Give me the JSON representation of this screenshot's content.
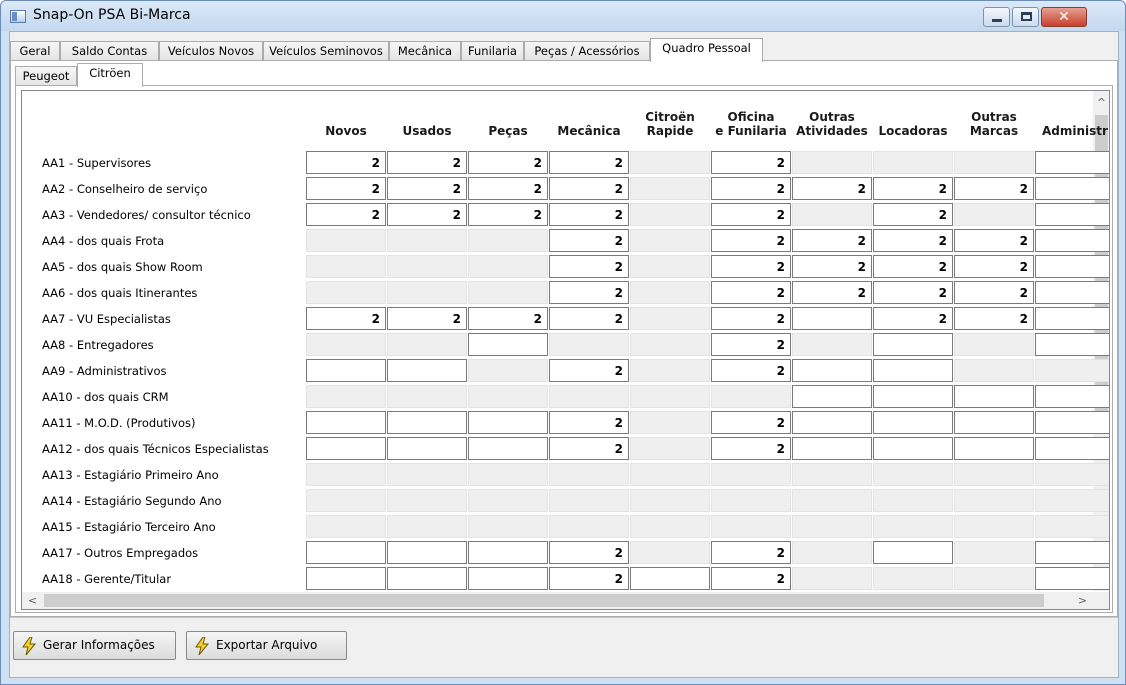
{
  "window": {
    "title": "Snap-On PSA Bi-Marca",
    "close_glyph": "✕"
  },
  "tabs": [
    {
      "label": "Geral"
    },
    {
      "label": "Saldo Contas"
    },
    {
      "label": "Veículos Novos"
    },
    {
      "label": "Veículos Seminovos"
    },
    {
      "label": "Mecânica"
    },
    {
      "label": "Funilaria"
    },
    {
      "label": "Peças / Acessórios"
    },
    {
      "label": "Quadro Pessoal",
      "active": true
    }
  ],
  "subtabs": [
    {
      "label": "Peugeot"
    },
    {
      "label": "Citröen",
      "active": true
    }
  ],
  "grid": {
    "columns": [
      {
        "l1": "",
        "l2": "Novos"
      },
      {
        "l1": "",
        "l2": "Usados"
      },
      {
        "l1": "",
        "l2": "Peças"
      },
      {
        "l1": "",
        "l2": "Mecânica"
      },
      {
        "l1": "Citroën",
        "l2": "Rapide"
      },
      {
        "l1": "Oficina",
        "l2": "e Funilaria"
      },
      {
        "l1": "Outras",
        "l2": "Atividades"
      },
      {
        "l1": "",
        "l2": "Locadoras"
      },
      {
        "l1": "Outras",
        "l2": "Marcas"
      },
      {
        "l1": "",
        "l2": "Administr"
      }
    ],
    "rows": [
      {
        "label": "AA1 - Supervisores",
        "cells": [
          [
            "w",
            "2"
          ],
          [
            "w",
            "2"
          ],
          [
            "w",
            "2"
          ],
          [
            "w",
            "2"
          ],
          [
            "g",
            ""
          ],
          [
            "w",
            "2"
          ],
          [
            "g",
            ""
          ],
          [
            "g",
            ""
          ],
          [
            "g",
            ""
          ],
          [
            "w",
            ""
          ]
        ]
      },
      {
        "label": "AA2 - Conselheiro de serviço",
        "cells": [
          [
            "w",
            "2"
          ],
          [
            "w",
            "2"
          ],
          [
            "w",
            "2"
          ],
          [
            "w",
            "2"
          ],
          [
            "g",
            ""
          ],
          [
            "w",
            "2"
          ],
          [
            "w",
            "2"
          ],
          [
            "w",
            "2"
          ],
          [
            "w",
            "2"
          ],
          [
            "w",
            ""
          ]
        ]
      },
      {
        "label": "AA3 - Vendedores/ consultor técnico",
        "cells": [
          [
            "w",
            "2"
          ],
          [
            "w",
            "2"
          ],
          [
            "w",
            "2"
          ],
          [
            "w",
            "2"
          ],
          [
            "g",
            ""
          ],
          [
            "w",
            "2"
          ],
          [
            "g",
            ""
          ],
          [
            "w",
            "2"
          ],
          [
            "g",
            ""
          ],
          [
            "w",
            ""
          ]
        ]
      },
      {
        "label": "AA4 - dos quais Frota",
        "cells": [
          [
            "g",
            ""
          ],
          [
            "g",
            ""
          ],
          [
            "g",
            ""
          ],
          [
            "w",
            "2"
          ],
          [
            "g",
            ""
          ],
          [
            "w",
            "2"
          ],
          [
            "w",
            "2"
          ],
          [
            "w",
            "2"
          ],
          [
            "w",
            "2"
          ],
          [
            "w",
            ""
          ]
        ]
      },
      {
        "label": "AA5 - dos quais Show Room",
        "cells": [
          [
            "g",
            ""
          ],
          [
            "g",
            ""
          ],
          [
            "g",
            ""
          ],
          [
            "w",
            "2"
          ],
          [
            "g",
            ""
          ],
          [
            "w",
            "2"
          ],
          [
            "w",
            "2"
          ],
          [
            "w",
            "2"
          ],
          [
            "w",
            "2"
          ],
          [
            "w",
            ""
          ]
        ]
      },
      {
        "label": "AA6 - dos quais Itinerantes",
        "cells": [
          [
            "g",
            ""
          ],
          [
            "g",
            ""
          ],
          [
            "g",
            ""
          ],
          [
            "w",
            "2"
          ],
          [
            "g",
            ""
          ],
          [
            "w",
            "2"
          ],
          [
            "w",
            "2"
          ],
          [
            "w",
            "2"
          ],
          [
            "w",
            "2"
          ],
          [
            "w",
            ""
          ]
        ]
      },
      {
        "label": "AA7 - VU Especialistas",
        "cells": [
          [
            "w",
            "2"
          ],
          [
            "w",
            "2"
          ],
          [
            "w",
            "2"
          ],
          [
            "w",
            "2"
          ],
          [
            "g",
            ""
          ],
          [
            "w",
            "2"
          ],
          [
            "w",
            ""
          ],
          [
            "w",
            "2"
          ],
          [
            "w",
            "2"
          ],
          [
            "w",
            ""
          ]
        ]
      },
      {
        "label": "AA8 - Entregadores",
        "cells": [
          [
            "g",
            ""
          ],
          [
            "g",
            ""
          ],
          [
            "w",
            ""
          ],
          [
            "g",
            ""
          ],
          [
            "g",
            ""
          ],
          [
            "w",
            "2"
          ],
          [
            "g",
            ""
          ],
          [
            "w",
            ""
          ],
          [
            "g",
            ""
          ],
          [
            "w",
            ""
          ]
        ]
      },
      {
        "label": "AA9 - Administrativos",
        "cells": [
          [
            "w",
            ""
          ],
          [
            "w",
            ""
          ],
          [
            "g",
            ""
          ],
          [
            "w",
            "2"
          ],
          [
            "g",
            ""
          ],
          [
            "w",
            "2"
          ],
          [
            "w",
            ""
          ],
          [
            "w",
            ""
          ],
          [
            "g",
            ""
          ],
          [
            "g",
            ""
          ]
        ]
      },
      {
        "label": "AA10 - dos quais CRM",
        "cells": [
          [
            "g",
            ""
          ],
          [
            "g",
            ""
          ],
          [
            "g",
            ""
          ],
          [
            "g",
            ""
          ],
          [
            "g",
            ""
          ],
          [
            "g",
            ""
          ],
          [
            "w",
            ""
          ],
          [
            "w",
            ""
          ],
          [
            "w",
            ""
          ],
          [
            "w",
            ""
          ]
        ]
      },
      {
        "label": "AA11 - M.O.D. (Produtivos)",
        "cells": [
          [
            "w",
            ""
          ],
          [
            "w",
            ""
          ],
          [
            "w",
            ""
          ],
          [
            "w",
            "2"
          ],
          [
            "g",
            ""
          ],
          [
            "w",
            "2"
          ],
          [
            "w",
            ""
          ],
          [
            "w",
            ""
          ],
          [
            "w",
            ""
          ],
          [
            "w",
            ""
          ]
        ]
      },
      {
        "label": "AA12 - dos quais Técnicos Especialistas",
        "cells": [
          [
            "w",
            ""
          ],
          [
            "w",
            ""
          ],
          [
            "w",
            ""
          ],
          [
            "w",
            "2"
          ],
          [
            "g",
            ""
          ],
          [
            "w",
            "2"
          ],
          [
            "w",
            ""
          ],
          [
            "w",
            ""
          ],
          [
            "w",
            ""
          ],
          [
            "w",
            ""
          ]
        ]
      },
      {
        "label": "AA13 - Estagiário Primeiro Ano",
        "cells": [
          [
            "g",
            ""
          ],
          [
            "g",
            ""
          ],
          [
            "g",
            ""
          ],
          [
            "g",
            ""
          ],
          [
            "g",
            ""
          ],
          [
            "g",
            ""
          ],
          [
            "g",
            ""
          ],
          [
            "g",
            ""
          ],
          [
            "g",
            ""
          ],
          [
            "g",
            ""
          ]
        ]
      },
      {
        "label": "AA14 - Estagiário Segundo Ano",
        "cells": [
          [
            "g",
            ""
          ],
          [
            "g",
            ""
          ],
          [
            "g",
            ""
          ],
          [
            "g",
            ""
          ],
          [
            "g",
            ""
          ],
          [
            "g",
            ""
          ],
          [
            "g",
            ""
          ],
          [
            "g",
            ""
          ],
          [
            "g",
            ""
          ],
          [
            "g",
            ""
          ]
        ]
      },
      {
        "label": "AA15 - Estagiário Terceiro Ano",
        "cells": [
          [
            "g",
            ""
          ],
          [
            "g",
            ""
          ],
          [
            "g",
            ""
          ],
          [
            "g",
            ""
          ],
          [
            "g",
            ""
          ],
          [
            "g",
            ""
          ],
          [
            "g",
            ""
          ],
          [
            "g",
            ""
          ],
          [
            "g",
            ""
          ],
          [
            "g",
            ""
          ]
        ]
      },
      {
        "label": "AA17 - Outros Empregados",
        "cells": [
          [
            "w",
            ""
          ],
          [
            "w",
            ""
          ],
          [
            "w",
            ""
          ],
          [
            "w",
            "2"
          ],
          [
            "g",
            ""
          ],
          [
            "w",
            "2"
          ],
          [
            "g",
            ""
          ],
          [
            "w",
            ""
          ],
          [
            "g",
            ""
          ],
          [
            "w",
            ""
          ]
        ]
      },
      {
        "label": "AA18 - Gerente/Titular",
        "cells": [
          [
            "w",
            ""
          ],
          [
            "w",
            ""
          ],
          [
            "w",
            ""
          ],
          [
            "w",
            "2"
          ],
          [
            "w",
            ""
          ],
          [
            "w",
            "2"
          ],
          [
            "g",
            ""
          ],
          [
            "g",
            ""
          ],
          [
            "g",
            ""
          ],
          [
            "w",
            ""
          ]
        ]
      }
    ]
  },
  "scroll_arrows": {
    "up": "^",
    "down": "⌄",
    "left": "<",
    "right": ">"
  },
  "buttons": {
    "gerar": "Gerar Informações",
    "exportar": "Exportar Arquivo"
  },
  "colors": {
    "bolt": "#f2d22e",
    "window_frame": "#cfe0f2"
  }
}
